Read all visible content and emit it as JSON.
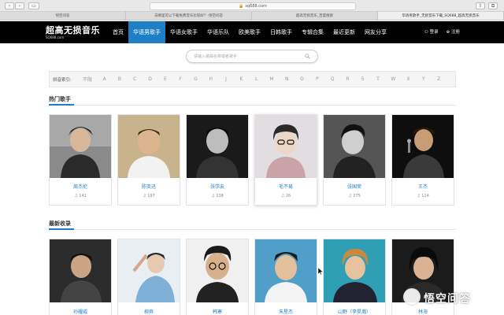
{
  "browser": {
    "url": "sq688.com",
    "tabs": [
      {
        "title": "悟空问答",
        "active": false
      },
      {
        "title": "去哪里可以下载免费音乐比较好？-悟空问答",
        "active": false
      },
      {
        "title": "超高无损音乐_百度搜索",
        "active": false
      },
      {
        "title": "华语男歌手_无损音乐下载_SQ688_超高无损音乐",
        "active": true
      }
    ]
  },
  "header": {
    "logo_title": "超高无损音乐",
    "logo_sub": "SQ688.com",
    "nav": [
      "首页",
      "华语男歌手",
      "华语女歌手",
      "华语乐队",
      "欧美歌手",
      "日韩歌手",
      "专辑合集",
      "最近更新",
      "网友分享"
    ],
    "active_nav": 1,
    "login": "登录",
    "register": "注册"
  },
  "search": {
    "placeholder": "请输入歌曲名称或者歌手"
  },
  "pinyin": {
    "label": "拼音索引:",
    "items": [
      "不限",
      "A",
      "B",
      "C",
      "D",
      "E",
      "F",
      "G",
      "H",
      "J",
      "K",
      "L",
      "M",
      "N",
      "O",
      "P",
      "Q",
      "R",
      "S",
      "T",
      "W",
      "X",
      "Y",
      "Z"
    ]
  },
  "hot_section": {
    "title": "热门歌手",
    "singers": [
      {
        "name": "周杰伦",
        "count": "♫ 141"
      },
      {
        "name": "陈奕迅",
        "count": "♫ 197"
      },
      {
        "name": "张学友",
        "count": "♫ 338"
      },
      {
        "name": "毛不易",
        "count": "♫ 26"
      },
      {
        "name": "张国荣",
        "count": "♫ 275"
      },
      {
        "name": "王杰",
        "count": "♫ 114"
      }
    ]
  },
  "new_section": {
    "title": "最新收录",
    "singers": [
      {
        "name": "孙耀威"
      },
      {
        "name": "柳爽"
      },
      {
        "name": "韩寒"
      },
      {
        "name": "朱星杰"
      },
      {
        "name": "山野（李昊瀚）"
      },
      {
        "name": "林海"
      }
    ]
  },
  "watermark": "悟空问答",
  "colors": {
    "accent": "#1e7fc5",
    "header_bg": "#000000"
  }
}
